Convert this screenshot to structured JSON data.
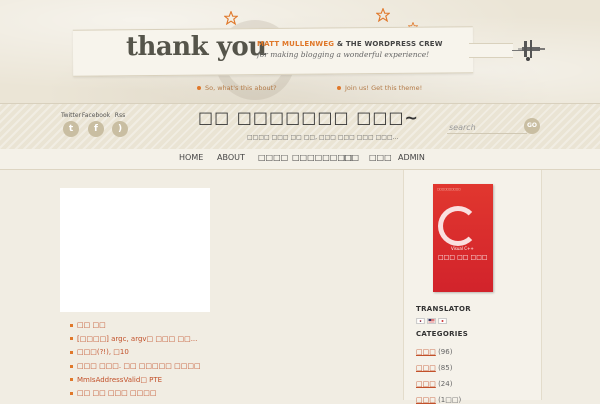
{
  "banner": {
    "title": "thank you",
    "credit_name": "MATT MULLENWEG",
    "credit_crew": "& THE WORDPRESS CREW",
    "credit_line2": "for making blogging a wonderful experience!",
    "link_about": "So, what's this about?",
    "link_join": "Join us! Get this theme!"
  },
  "social": [
    {
      "label": "Twitter",
      "icon": "twitter-icon",
      "glyph": "t"
    },
    {
      "label": "Facebook",
      "icon": "facebook-icon",
      "glyph": "f"
    },
    {
      "label": "Rss",
      "icon": "rss-icon",
      "glyph": ")"
    }
  ],
  "header": {
    "blog_title": "□□ □□□□□□□ □□□~",
    "tagline": "□□□□ □□□ □□ □□, □□□ □□□ □□□ □□□...",
    "search_placeholder": "search",
    "search_button": "GO"
  },
  "nav": {
    "items": [
      "HOME",
      "ABOUT",
      "□□□□",
      "□□□□□□□□",
      "□□",
      "□□□",
      "ADMIN"
    ]
  },
  "posts": [
    "□□ □□",
    "[□□□□] argc, argv□ □□□ □□...",
    "□□□(?!), □10",
    "□□□ □□□. □□ □□□□□ □□□□",
    "MmIsAddressValid□ PTE",
    "□□ □□ □□□ □□□□"
  ],
  "sidebar": {
    "book": {
      "top_text": "□□□□□□□□□□",
      "subtitle": "Visual C++",
      "title": "□□□ □□ □□□"
    },
    "translator_heading": "TRANSLATOR",
    "categories_heading": "CATEGORIES",
    "categories": [
      {
        "name": "□□□",
        "count": "(96)"
      },
      {
        "name": "□□□",
        "count": "(85)"
      },
      {
        "name": "□□□",
        "count": "(24)"
      },
      {
        "name": "□□□",
        "count": "(1□□)"
      }
    ]
  },
  "colors": {
    "accent": "#e0782a",
    "link": "#c2512a",
    "book": "#d2232b",
    "background": "#f1ede3"
  }
}
